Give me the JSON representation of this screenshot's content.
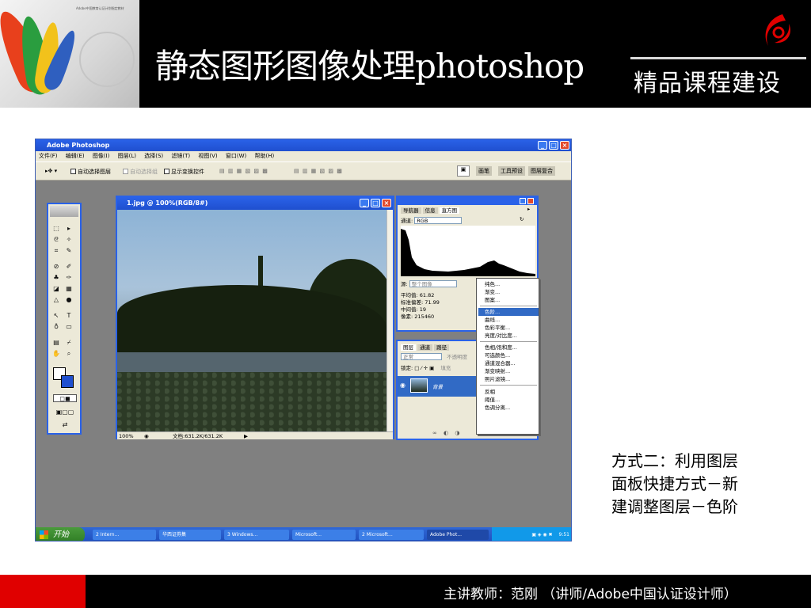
{
  "header": {
    "title": "静态图形图像处理photoshop",
    "brand_text": "精品课程建设",
    "logo_tiny_text": "Adobe中国教育认证计划指定教材",
    "colors": {
      "background": "#000000",
      "brand_accent": "#e00000"
    }
  },
  "screenshot": {
    "app_title": "Adobe Photoshop",
    "menu": [
      "文件(F)",
      "编辑(E)",
      "图像(I)",
      "图层(L)",
      "选择(S)",
      "滤镜(T)",
      "视图(V)",
      "窗口(W)",
      "帮助(H)"
    ],
    "options": {
      "auto_select": "自动选择图层",
      "auto_select_group": "自动选择组",
      "show_transform": "显示变换控件"
    },
    "palette_tabs": [
      "画笔",
      "工具预设",
      "图层复合"
    ],
    "image_window": {
      "title": "1.jpg @ 100%(RGB/8#)",
      "zoom": "100%",
      "doc_info": "文档:631.2K/631.2K"
    },
    "histogram": {
      "tabs": [
        "导航器",
        "信息",
        "直方图"
      ],
      "channel_label": "通道:",
      "channel_value": "RGB",
      "source_label": "源:",
      "source_value": "整个图像",
      "stats": [
        {
          "label": "平均值:",
          "value": "61.82"
        },
        {
          "label": "标准偏差:",
          "value": "71.99"
        },
        {
          "label": "中间值:",
          "value": "19"
        },
        {
          "label": "像素:",
          "value": "215460"
        }
      ]
    },
    "layers": {
      "tabs": [
        "图层",
        "通道",
        "路径"
      ],
      "blend_mode": "正常",
      "opacity_label": "不透明度",
      "lock_label": "锁定:",
      "fill_label": "填充",
      "layer_name": "背景"
    },
    "context_menu": {
      "items": [
        "纯色...",
        "渐变...",
        "图案...",
        "色阶...",
        "曲线...",
        "色彩平衡...",
        "亮度/对比度...",
        "色相/饱和度...",
        "可选颜色...",
        "通道混合器...",
        "渐变映射...",
        "照片滤镜...",
        "反相",
        "阈值...",
        "色调分离..."
      ],
      "selected": "色阶..."
    },
    "taskbar": {
      "start": "开始",
      "tasks": [
        "2 Intern...",
        "华西证券集",
        "3 Windows...",
        "Microsoft...",
        "2 Microsoft...",
        "Adobe Phot..."
      ],
      "clock": "9:51"
    }
  },
  "caption": {
    "lines": [
      "方式二：利用图层",
      "面板快捷方式－新",
      "建调整图层－色阶"
    ]
  },
  "footer": {
    "text": "主讲教师：范刚 （讲师/Adobe中国认证设计师）"
  }
}
